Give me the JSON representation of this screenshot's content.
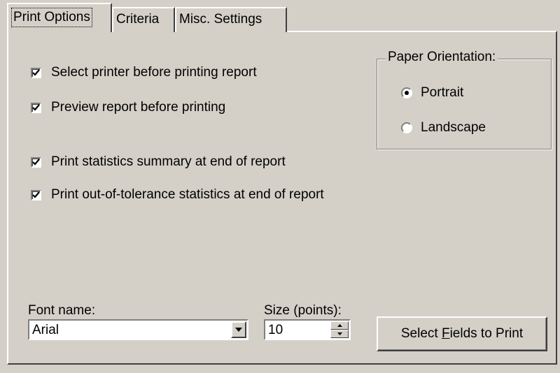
{
  "tabs": [
    "Print Options",
    "Criteria",
    "Misc. Settings"
  ],
  "options": {
    "select_printer": "Select printer before printing report",
    "preview_report": "Preview report before printing",
    "stats_summary": "Print statistics summary at end of report",
    "oot_stats": "Print out-of-tolerance statistics at end of report"
  },
  "paper_orientation": {
    "title": "Paper Orientation:",
    "portrait": "Portrait",
    "landscape": "Landscape",
    "selected": "Portrait"
  },
  "font": {
    "name_label": "Font name:",
    "name_value": "Arial",
    "size_label": "Size (points):",
    "size_value": "10"
  },
  "select_fields_button": {
    "pre": "Select ",
    "accel": "F",
    "post": "ields to Print"
  }
}
